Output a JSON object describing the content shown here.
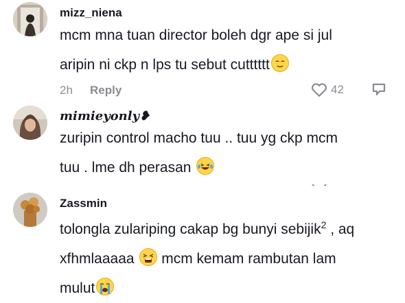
{
  "comments": [
    {
      "username": "mizz_niena",
      "text_line1": "mcm mna tuan director boleh dgr ape si jul",
      "text_line2": "aripin ni ckp n lps tu sebut cutttttt",
      "time": "2h",
      "reply_label": "Reply",
      "likes": "42",
      "emoji": "relieved-face-icon"
    },
    {
      "username": "mimieyonly❥",
      "text_line1": "zuripin control macho tuu .. tuu yg ckp mcm",
      "text_line2": "tuu . lme dh perasan",
      "emoji": "tears-of-joy-icon"
    },
    {
      "username": "Zassmin",
      "text_line1": "tolongla zulariping cakap bg bunyi sebijik",
      "superscript": "2",
      "text_line1_end": " , aq",
      "text_line2_start": "xfhmlaaaaa ",
      "text_line2_end": " mcm kemam rambutan lam",
      "text_line3": "mulut",
      "emojis": [
        "tired-face-icon",
        "sob-face-icon"
      ]
    }
  ],
  "colors": {
    "text": "#161823",
    "muted": "#8a8b91",
    "emoji_yellow": "#ffd54a"
  }
}
